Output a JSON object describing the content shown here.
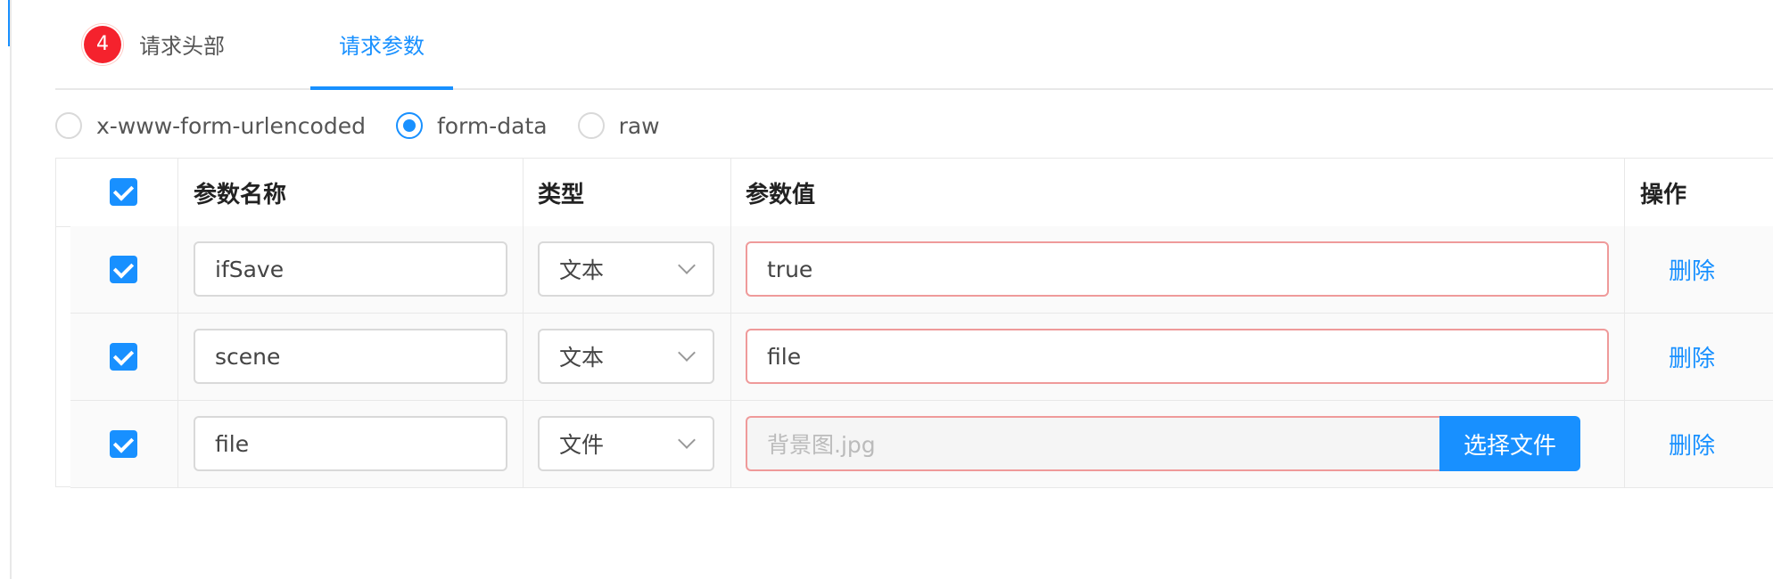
{
  "tabs": {
    "headers": {
      "badge": "4",
      "label": "请求头部"
    },
    "params": {
      "label": "请求参数"
    }
  },
  "body_types": {
    "options": [
      "x-www-form-urlencoded",
      "form-data",
      "raw"
    ],
    "selected": "form-data"
  },
  "table": {
    "columns": [
      "参数名称",
      "类型",
      "参数值",
      "操作"
    ],
    "rows": [
      {
        "checked": true,
        "name": "ifSave",
        "type": "文本",
        "value": "true",
        "action": "删除"
      },
      {
        "checked": true,
        "name": "scene",
        "type": "文本",
        "value": "file",
        "action": "删除"
      },
      {
        "checked": true,
        "name": "file",
        "type": "文件",
        "value_placeholder": "背景图.jpg",
        "file_button": "选择文件",
        "action": "删除"
      }
    ]
  },
  "colors": {
    "accent": "#1890ff",
    "badge": "#f5222d",
    "error_border": "#ef9a9a"
  }
}
